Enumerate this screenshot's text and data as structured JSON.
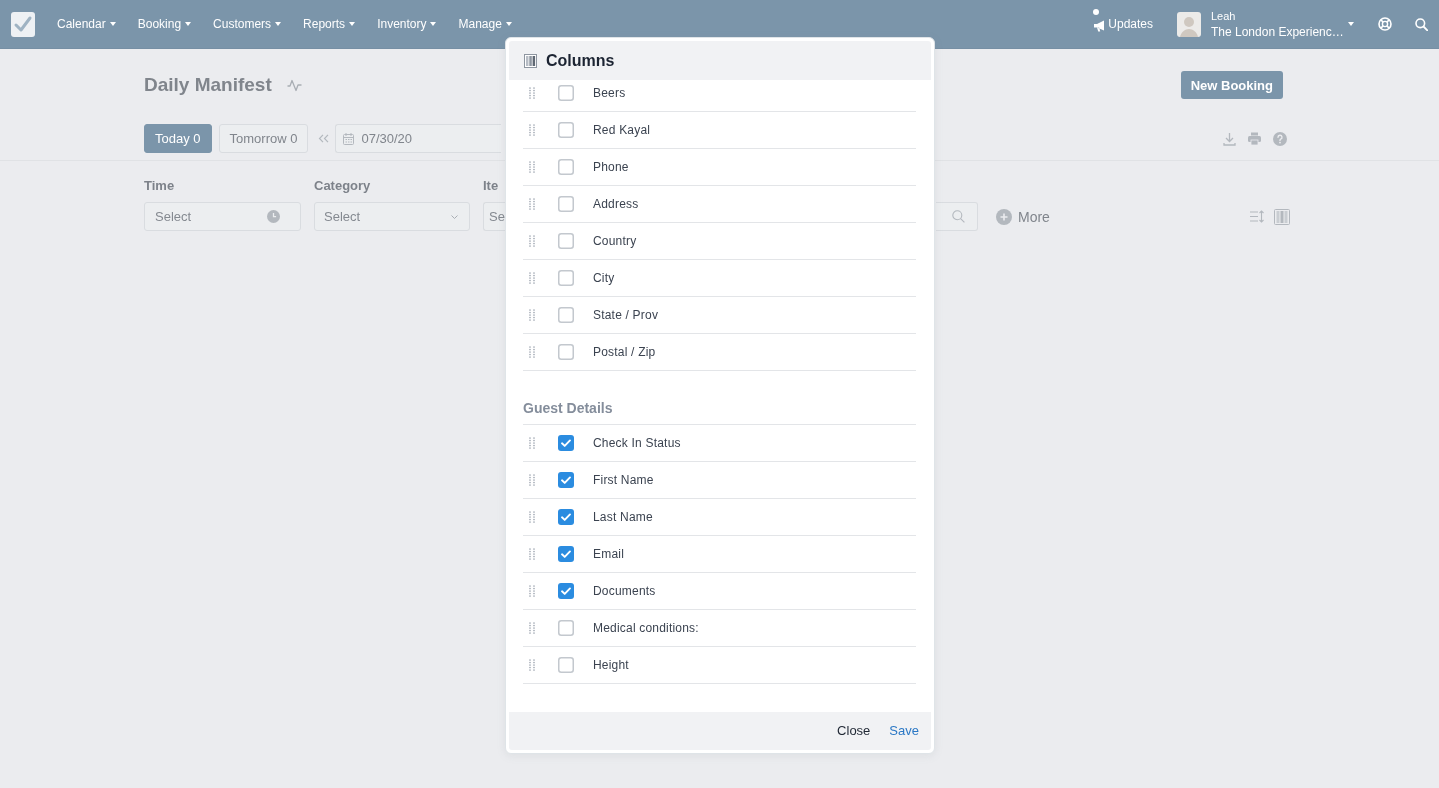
{
  "nav": {
    "menu": [
      {
        "label": "Calendar"
      },
      {
        "label": "Booking"
      },
      {
        "label": "Customers"
      },
      {
        "label": "Reports"
      },
      {
        "label": "Inventory"
      },
      {
        "label": "Manage"
      }
    ],
    "updates": {
      "label": "Updates",
      "unread": true
    },
    "user": {
      "name": "Leah",
      "company": "The London Experienc…"
    }
  },
  "page": {
    "title": "Daily Manifest",
    "new_booking": "New Booking"
  },
  "toolbar": {
    "day_tabs": [
      {
        "label": "Today 0",
        "selected": true
      },
      {
        "label": "Tomorrow 0",
        "selected": false
      }
    ],
    "date": "07/30/20"
  },
  "filters": [
    {
      "label": "Time",
      "placeholder": "Select",
      "kind": "time"
    },
    {
      "label": "Category",
      "placeholder": "Select",
      "kind": "select"
    },
    {
      "label": "Ite",
      "placeholder": "Se",
      "kind": "clipped"
    }
  ],
  "more": "More",
  "modal": {
    "title": "Columns",
    "sections": [
      {
        "items": [
          {
            "label": "Beers",
            "checked": false
          },
          {
            "label": "Red Kayal",
            "checked": false
          },
          {
            "label": "Phone",
            "checked": false
          },
          {
            "label": "Address",
            "checked": false
          },
          {
            "label": "Country",
            "checked": false
          },
          {
            "label": "City",
            "checked": false
          },
          {
            "label": "State / Prov",
            "checked": false
          },
          {
            "label": "Postal / Zip",
            "checked": false
          }
        ]
      },
      {
        "heading": "Guest Details",
        "items": [
          {
            "label": "Check In Status",
            "checked": true
          },
          {
            "label": "First Name",
            "checked": true
          },
          {
            "label": "Last Name",
            "checked": true
          },
          {
            "label": "Email",
            "checked": true
          },
          {
            "label": "Documents",
            "checked": true
          },
          {
            "label": "Medical conditions:",
            "checked": false
          },
          {
            "label": "Height",
            "checked": false
          }
        ]
      }
    ],
    "buttons": [
      {
        "label": "Close",
        "kind": "secondary"
      },
      {
        "label": "Save",
        "kind": "primary"
      }
    ]
  }
}
